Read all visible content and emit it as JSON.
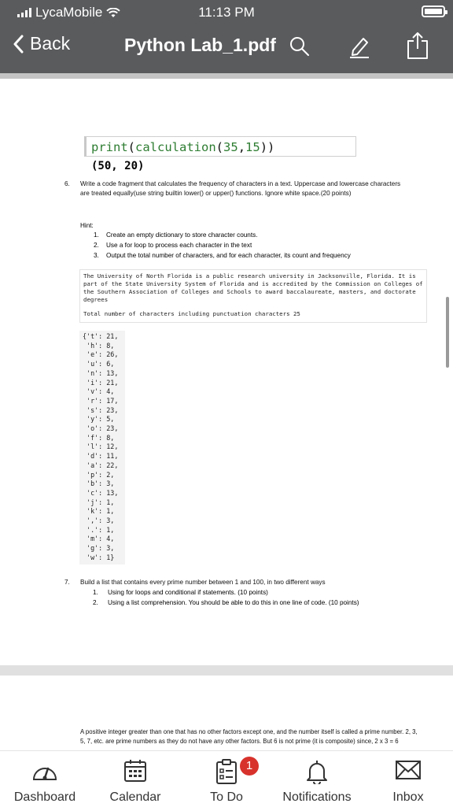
{
  "status_bar": {
    "carrier": "LycaMobile",
    "time": "11:13 PM"
  },
  "nav": {
    "back_label": "Back",
    "title": "Python Lab_1.pdf"
  },
  "document": {
    "code_input": "print(calculation(35,15))",
    "code_output": "(50, 20)",
    "q6": {
      "number": "6.",
      "text": "Write a code fragment that calculates the frequency of characters in a text. Uppercase and lowercase characters are treated equally(use string builtin lower() or upper() functions. Ignore white space.(20 points)"
    },
    "hint_label": "Hint:",
    "hints": [
      {
        "n": "1.",
        "text": "Create an empty dictionary to store character counts."
      },
      {
        "n": "2.",
        "text": "Use a for loop to process each character in the text"
      },
      {
        "n": "3.",
        "text": "Output the total number of characters, and for each character, its count and frequency"
      }
    ],
    "sample_text": "The University of North Florida is a public research university in Jacksonville, Florida. It is part of the State University System of Florida and is accredited by the Commission on Colleges of the Southern Association of Colleges and Schools to award baccalaureate, masters, and doctorate degrees",
    "total_line": "Total number of characters including punctuation characters 25",
    "dict_lines": [
      "{'t': 21,",
      " 'h': 8,",
      " 'e': 26,",
      " 'u': 6,",
      " 'n': 13,",
      " 'i': 21,",
      " 'v': 4,",
      " 'r': 17,",
      " 's': 23,",
      " 'y': 5,",
      " 'o': 23,",
      " 'f': 8,",
      " 'l': 12,",
      " 'd': 11,",
      " 'a': 22,",
      " 'p': 2,",
      " 'b': 3,",
      " 'c': 13,",
      " 'j': 1,",
      " 'k': 1,",
      " ',': 3,",
      " '.': 1,",
      " 'm': 4,",
      " 'g': 3,",
      " 'w': 1}"
    ],
    "q7": {
      "number": "7.",
      "text": "Build a list that contains every prime number between 1 and 100, in two different ways",
      "items": [
        {
          "n": "1.",
          "text": "Using for loops and conditional if statements. (10 points)"
        },
        {
          "n": "2.",
          "text": "Using a list comprehension. You should be able to do this in one line of code. (10 points)"
        }
      ]
    },
    "page2_text": "A positive integer greater than one that has no other factors except one, and the number itself is called a prime number. 2, 3, 5, 7, etc. are prime numbers as they do not have any other factors. But 6 is not prime (it is composite) since, 2 x 3 = 6"
  },
  "tabs": [
    {
      "label": "Dashboard",
      "icon": "dashboard-icon"
    },
    {
      "label": "Calendar",
      "icon": "calendar-icon"
    },
    {
      "label": "To Do",
      "icon": "todo-icon",
      "badge": "1"
    },
    {
      "label": "Notifications",
      "icon": "bell-icon"
    },
    {
      "label": "Inbox",
      "icon": "inbox-icon"
    }
  ],
  "colors": {
    "toolbar": "#5a5b5d",
    "badge": "#d8322c",
    "code_green": "#2e7d32"
  }
}
